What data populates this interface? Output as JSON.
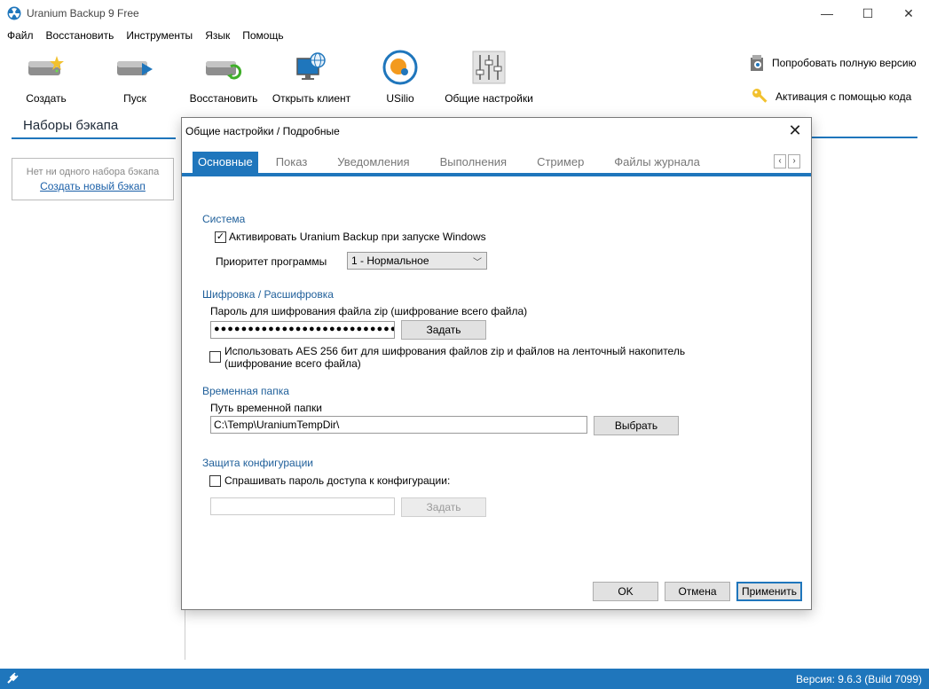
{
  "window": {
    "title": "Uranium Backup 9 Free",
    "minimize": "—",
    "maximize": "☐",
    "close": "✕"
  },
  "menu": [
    "Файл",
    "Восстановить",
    "Инструменты",
    "Язык",
    "Помощь"
  ],
  "toolbar": {
    "create": "Создать",
    "start": "Пуск",
    "restore": "Восстановить",
    "open_client": "Открыть клиент",
    "usilio": "USilio",
    "general_settings": "Общие настройки",
    "try_full": "Попробовать полную версию",
    "activate": "Активация с помощью кода"
  },
  "sets": {
    "title": "Наборы бэкапа",
    "empty": "Нет ни одного набора бэкапа",
    "create_new": "Создать новый бэкап"
  },
  "status": {
    "version": "Версия: 9.6.3 (Build 7099)"
  },
  "dialog": {
    "title": "Общие настройки / Подробные",
    "close": "✕",
    "tabs": [
      "Основные",
      "Показ",
      "Уведомления",
      "Выполнения",
      "Стример",
      "Файлы журнала"
    ],
    "tab_prev": "‹",
    "tab_next": "›",
    "system": {
      "heading": "Система",
      "autostart_label": "Активировать Uranium Backup при запуске Windows",
      "autostart_checked": "✓",
      "priority_label": "Приоритет программы",
      "priority_value": "1 - Нормальное"
    },
    "encryption": {
      "heading": "Шифровка / Расшифровка",
      "password_label": "Пароль для шифрования файла zip (шифрование всего файла)",
      "password_value": "●●●●●●●●●●●●●●●●●●●●●●●●●●●●●●",
      "set_button": "Задать",
      "aes_label_line1": "Использовать AES 256 бит для шифрования файлов zip и файлов на ленточный накопитель",
      "aes_label_line2": "(шифрование всего файла)"
    },
    "temp": {
      "heading": "Временная папка",
      "path_label": "Путь временной папки",
      "path_value": "C:\\Temp\\UraniumTempDir\\",
      "choose_button": "Выбрать"
    },
    "config": {
      "heading": "Защита конфигурации",
      "ask_label": "Спрашивать пароль доступа к конфигурации:",
      "set_button": "Задать"
    },
    "buttons": {
      "ok": "OK",
      "cancel": "Отмена",
      "apply": "Применить"
    }
  }
}
